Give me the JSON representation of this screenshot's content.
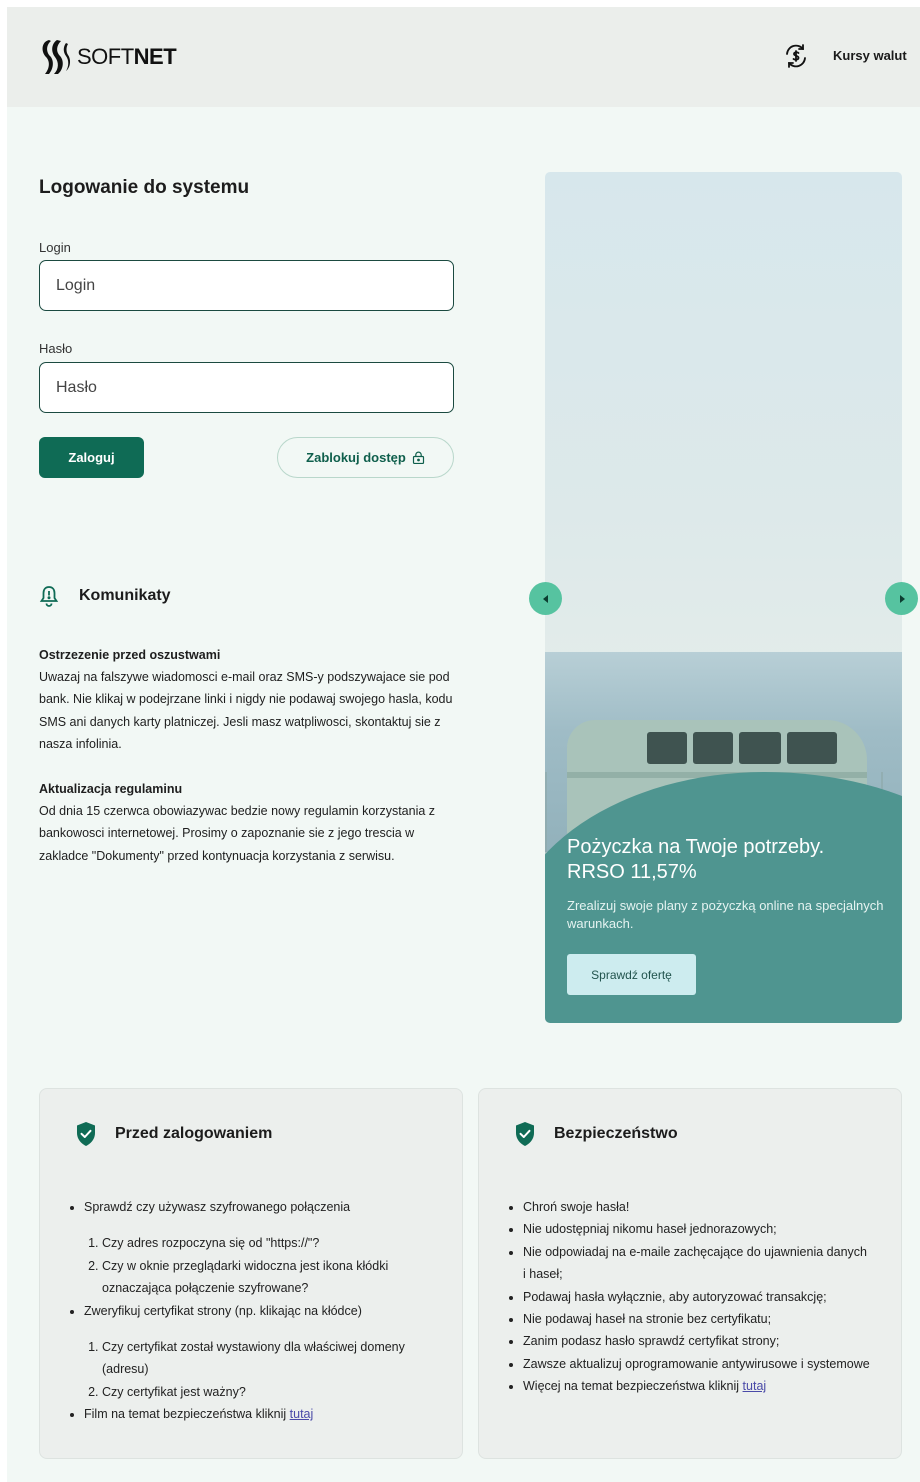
{
  "header": {
    "logo_text_light": "SOFT",
    "logo_text_bold": "NET",
    "fx_link": "Kursy walut"
  },
  "login": {
    "title": "Logowanie do systemu",
    "login_label": "Login",
    "login_placeholder": "Login",
    "password_label": "Hasło",
    "password_placeholder": "Hasło",
    "submit_label": "Zaloguj",
    "block_label": "Zablokuj dostęp"
  },
  "notices": {
    "title": "Komunikaty",
    "items": [
      {
        "title": "Ostrzezenie przed oszustwami",
        "body": "Uwazaj na falszywe wiadomosci e-mail oraz SMS-y podszywajace sie pod bank. Nie klikaj w podejrzane linki i nigdy nie podawaj swojego hasla, kodu SMS ani danych karty platniczej. Jesli masz watpliwosci, skontaktuj sie z nasza infolinia."
      },
      {
        "title": "Aktualizacja regulaminu",
        "body": "Od dnia 15 czerwca obowiazywac bedzie nowy regulamin korzystania z bankowosci internetowej. Prosimy o zapoznanie sie z jego trescia w zakladce \"Dokumenty\" przed kontynuacja korzystania z serwisu."
      }
    ]
  },
  "promo": {
    "title": "Pożyczka na Twoje potrzeby. RRSO 11,57%",
    "subtitle": "Zrealizuj swoje plany z pożyczką online na specjalnych warunkach.",
    "button": "Sprawdź ofertę"
  },
  "before_login": {
    "title": "Przed zalogowaniem",
    "item1": "Sprawdź czy używasz szyfrowanego połączenia",
    "item1_sub1": "Czy adres rozpoczyna się od \"https://\"?",
    "item1_sub2": "Czy w oknie przeglądarki widoczna jest ikona kłódki oznaczająca połączenie szyfrowane?",
    "item2": "Zweryfikuj certyfikat strony (np. klikając na kłódce)",
    "item2_sub1": "Czy certyfikat został wystawiony dla właściwej domeny (adresu)",
    "item2_sub2": "Czy certyfikat jest ważny?",
    "item3_text": "Film na temat bezpieczeństwa kliknij ",
    "item3_link": "tutaj"
  },
  "security": {
    "title": "Bezpieczeństwo",
    "items": [
      "Chroń swoje hasła!",
      "Nie udostępniaj nikomu haseł jednorazowych;",
      "Nie odpowiadaj na e-maile zachęcające do ujawnienia danych i haseł;",
      "Podawaj hasła wyłącznie, aby autoryzować transakcję;",
      "Nie podawaj haseł na stronie bez certyfikatu;",
      "Zanim podasz hasło sprawdź certyfikat strony;",
      "Zawsze aktualizuj oprogramowanie antywirusowe i systemowe"
    ],
    "last_text": "Więcej na temat bezpieczeństwa kliknij ",
    "last_link": "tutaj"
  },
  "colors": {
    "primary": "#0f6b55",
    "accent": "#56c3a0",
    "promo_panel": "#4f9590",
    "background": "#f2f8f5"
  },
  "icons": [
    "logo-mark-icon",
    "currency-exchange-icon",
    "lock-icon",
    "bell-alert-icon",
    "arrow-left-icon",
    "arrow-right-icon",
    "shield-check-icon"
  ]
}
